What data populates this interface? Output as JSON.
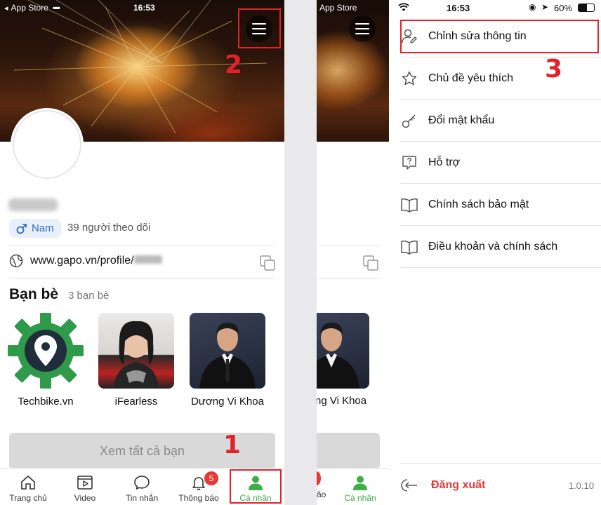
{
  "left": {
    "status": {
      "carrier": "App Store",
      "signal": "▪▪▪▪",
      "time": "16:53"
    },
    "profile": {
      "gender_label": "Nam",
      "followers": "39 người theo dõi",
      "website": "www.gapo.vn/profile/"
    },
    "friends": {
      "title": "Bạn bè",
      "count": "3 bạn bè",
      "items": [
        {
          "name": "Techbike.vn"
        },
        {
          "name": "iFearless"
        },
        {
          "name": "Dương Vi Khoa"
        }
      ],
      "see_all": "Xem tất cả bạn"
    },
    "tabs": [
      {
        "label": "Trang chủ",
        "icon": "home-icon"
      },
      {
        "label": "Video",
        "icon": "video-icon"
      },
      {
        "label": "Tin nhắn",
        "icon": "chat-icon"
      },
      {
        "label": "Thông báo",
        "icon": "bell-icon",
        "badge": "5"
      },
      {
        "label": "Cá nhân",
        "icon": "person-icon",
        "active": true
      }
    ],
    "annotations": {
      "n1": "1",
      "n2": "2"
    }
  },
  "right": {
    "status": {
      "carrier": "App Store",
      "time": "16:53",
      "battery": "60%"
    },
    "partial_friend": "ng Vi Khoa",
    "partial_tab_label": "ão",
    "partial_tab_active": "Cá nhân",
    "menu": [
      {
        "label": "Chỉnh sửa thông tin",
        "icon": "edit-profile-icon"
      },
      {
        "label": "Chủ đề yêu thích",
        "icon": "star-icon"
      },
      {
        "label": "Đổi mật khẩu",
        "icon": "key-icon"
      },
      {
        "label": "Hỗ trợ",
        "icon": "help-icon"
      },
      {
        "label": "Chính sách bảo mật",
        "icon": "book-icon"
      },
      {
        "label": "Điều khoản và chính sách",
        "icon": "book-icon"
      }
    ],
    "logout": "Đăng xuất",
    "version": "1.0.10",
    "annotations": {
      "n3": "3"
    }
  },
  "colors": {
    "accent_green": "#3fae49",
    "annotation_red": "#e0232a",
    "badge_red": "#e53935",
    "link_blue": "#2f6fc6"
  }
}
